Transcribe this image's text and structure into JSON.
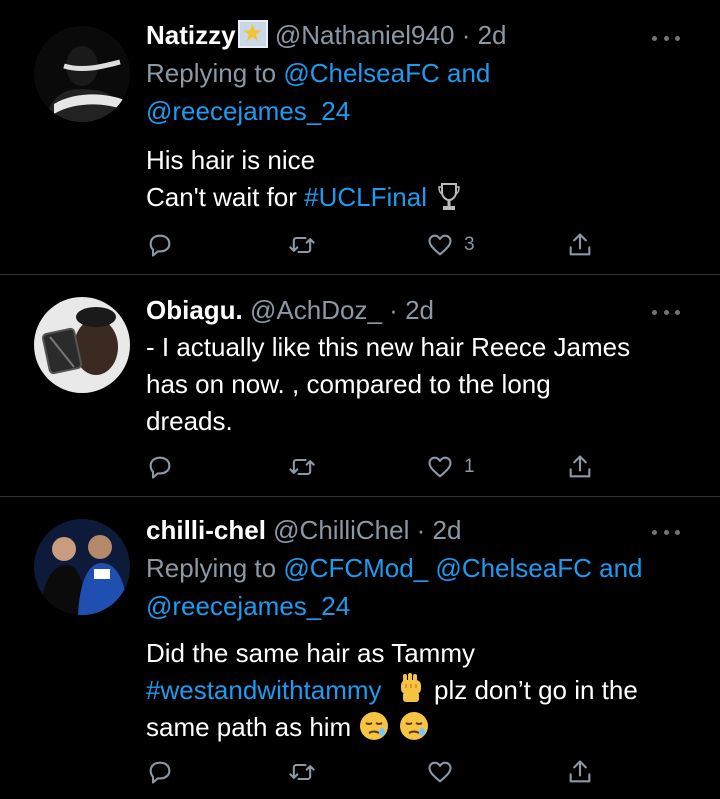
{
  "tweets": [
    {
      "name": "Natizzy",
      "handle": "@Nathaniel940",
      "separator": "·",
      "time": "2d",
      "reply_prefix": "Replying to",
      "reply_mentions": [
        "@ChelseaFC",
        "@reecejames_24"
      ],
      "reply_and": "and",
      "body_lines": [
        "His hair is nice",
        "Can't wait for "
      ],
      "hashtag": "#UCLFinal",
      "likes": "3"
    },
    {
      "name": "Obiagu.",
      "handle": "@AchDoz_",
      "separator": "·",
      "time": "2d",
      "body_lines": [
        "- I actually like this new hair Reece James",
        "has on now. , compared to the long",
        "dreads."
      ],
      "likes": "1"
    },
    {
      "name": "chilli-chel",
      "handle": "@ChilliChel",
      "separator": "·",
      "time": "2d",
      "reply_prefix": "Replying to",
      "reply_mentions": [
        "@CFCMod_",
        "@ChelseaFC",
        "@reecejames_24"
      ],
      "reply_and": "and",
      "body_line1": "Did the same hair as Tammy",
      "hashtag": "#westandwithtammy",
      "body_line2_rest": " plz don’t go in the",
      "body_line3": "same path as him ",
      "likes": ""
    }
  ],
  "icons": {
    "reply": "reply-icon",
    "retweet": "retweet-icon",
    "like": "heart-icon",
    "share": "share-icon",
    "more": "more-icon",
    "trophy": "trophy-icon",
    "fist": "raised-fist-emoji",
    "sleepy": "sleepy-face-emoji"
  },
  "colors": {
    "background": "#000000",
    "link": "#1d9bf0",
    "secondary": "#8b98a5",
    "divider": "#2f3336"
  }
}
